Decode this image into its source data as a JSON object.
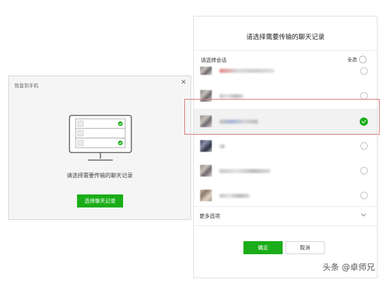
{
  "left_dialog": {
    "title": "恢复到手机",
    "close": "×",
    "prompt": "请选择需要传输的聊天记录",
    "select_button": "选择聊天记录"
  },
  "right_panel": {
    "title": "请选择需要传输的聊天记录",
    "section_label": "请选择会话",
    "select_all": "全选",
    "rows": [
      {
        "checked": false
      },
      {
        "checked": false
      },
      {
        "checked": true
      },
      {
        "checked": false
      },
      {
        "checked": false
      },
      {
        "checked": false
      }
    ],
    "more_options": "更多选项",
    "ok_button": "确定",
    "cancel_button": "取消"
  },
  "watermark": "头条 @卓师兄",
  "colors": {
    "accent_green": "#1aad19",
    "highlight_red": "#d77a7a"
  },
  "icons": {
    "monitor": "monitor-icon",
    "check": "checkmark-icon",
    "chevron": "chevron-down-icon",
    "close": "close-icon"
  }
}
